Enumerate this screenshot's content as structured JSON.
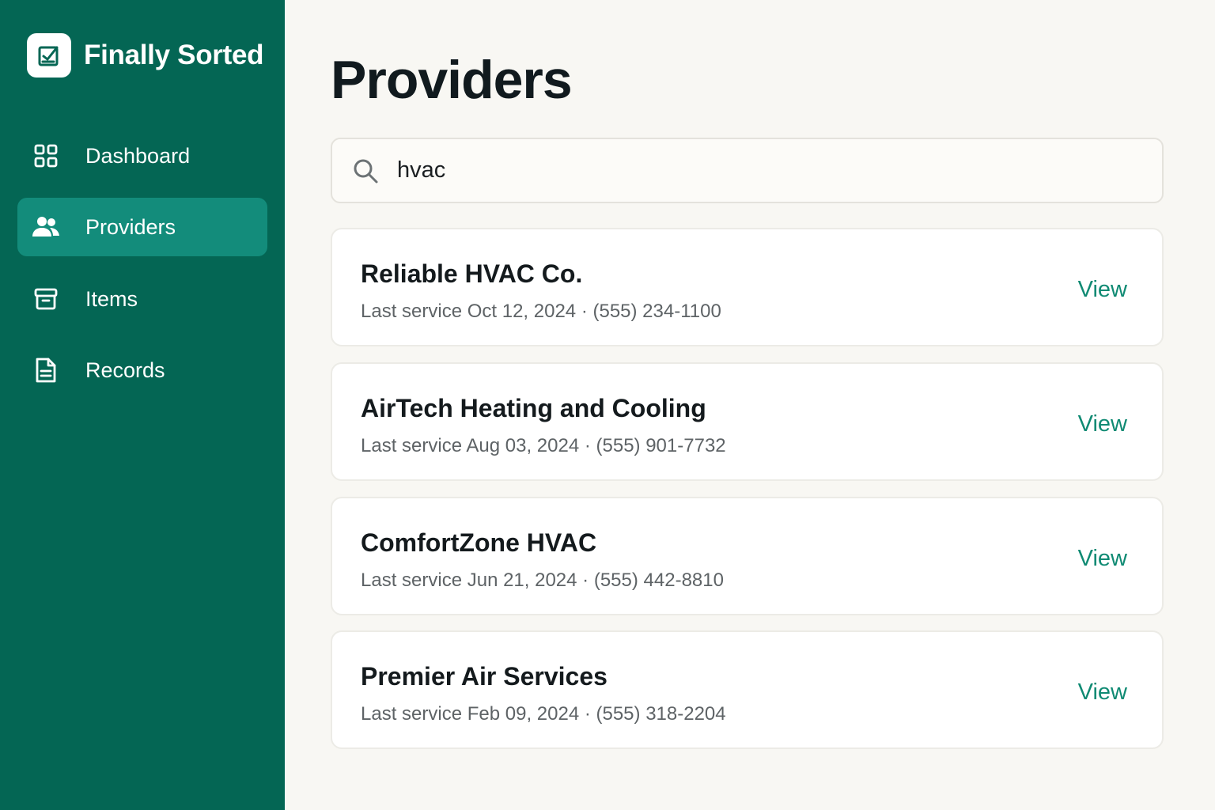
{
  "app": {
    "name": "Finally Sorted"
  },
  "sidebar": {
    "items": [
      {
        "label": "Dashboard",
        "icon": "grid-icon",
        "active": false
      },
      {
        "label": "Providers",
        "icon": "users-icon",
        "active": true
      },
      {
        "label": "Items",
        "icon": "archive-box-icon",
        "active": false
      },
      {
        "label": "Records",
        "icon": "document-icon",
        "active": false
      }
    ]
  },
  "page": {
    "title": "Providers"
  },
  "search": {
    "value": "hvac",
    "icon": "search-icon"
  },
  "providers": [
    {
      "name": "Reliable HVAC Co.",
      "meta": "Last service Oct 12, 2024 · (555) 234-1100",
      "action": "View"
    },
    {
      "name": "AirTech Heating and Cooling",
      "meta": "Last service Aug 03, 2024 · (555) 901-7732",
      "action": "View"
    },
    {
      "name": "ComfortZone HVAC",
      "meta": "Last service Jun 21, 2024 · (555) 442-8810",
      "action": "View"
    },
    {
      "name": "Premier Air Services",
      "meta": "Last service Feb 09, 2024 · (555) 318-2204",
      "action": "View"
    }
  ],
  "colors": {
    "sidebar": "#046654",
    "active_nav": "#138c7b",
    "accent": "#0f8a73",
    "background": "#f8f7f3"
  }
}
